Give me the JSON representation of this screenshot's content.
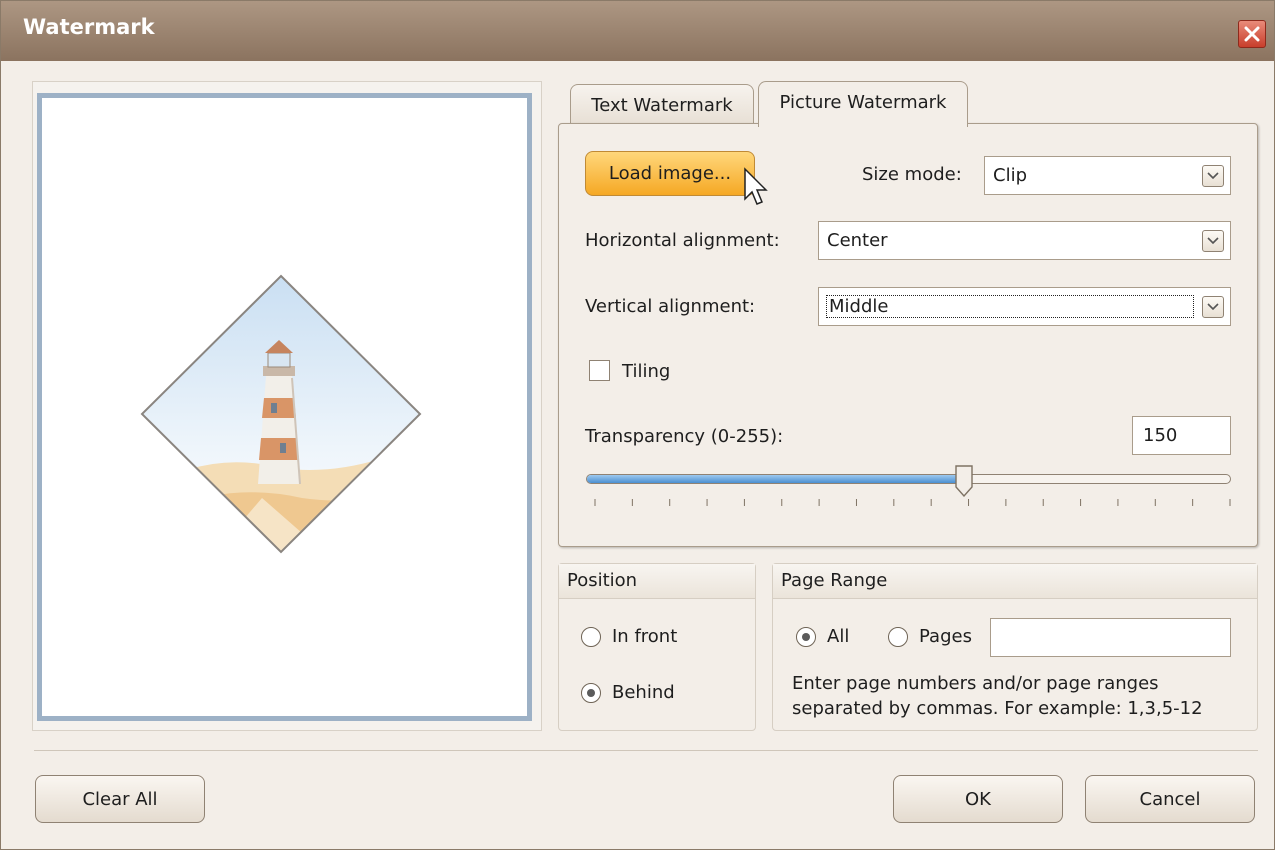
{
  "window": {
    "title": "Watermark"
  },
  "tabs": [
    {
      "label": "Text Watermark",
      "selected": false
    },
    {
      "label": "Picture Watermark",
      "selected": true
    }
  ],
  "picture": {
    "load_button": "Load image...",
    "size_mode_label": "Size mode:",
    "size_mode_value": "Clip",
    "halign_label": "Horizontal alignment:",
    "halign_value": "Center",
    "valign_label": "Vertical alignment:",
    "valign_value": "Middle",
    "tiling_label": "Tiling",
    "tiling_checked": false,
    "transparency_label": "Transparency (0-255):",
    "transparency_value": "150",
    "transparency_fraction": 0.588
  },
  "position": {
    "title": "Position",
    "in_front_label": "In front",
    "behind_label": "Behind",
    "selected": "Behind"
  },
  "page_range": {
    "title": "Page Range",
    "all_label": "All",
    "pages_label": "Pages",
    "pages_value": "",
    "hint_line1": "Enter page numbers and/or page ranges",
    "hint_line2": "separated by commas. For example: 1,3,5-12",
    "selected": "All"
  },
  "buttons": {
    "clear_all": "Clear All",
    "ok": "OK",
    "cancel": "Cancel"
  },
  "colors": {
    "titlebar": "#9c8470",
    "accent_button": "#f7b733",
    "slider_fill": "#4b8fd1",
    "page_border": "#9db1c6"
  }
}
